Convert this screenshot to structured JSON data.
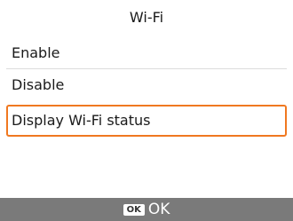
{
  "header": {
    "title": "Wi-Fi"
  },
  "menu": {
    "items": [
      {
        "label": "Enable"
      },
      {
        "label": "Disable"
      },
      {
        "label": "Display Wi-Fi status"
      }
    ],
    "selected_index": 2
  },
  "footer": {
    "ok_key": "OK",
    "ok_label": "OK"
  },
  "colors": {
    "selection_border": "#f07820",
    "footer_background": "#7a7a7a"
  }
}
